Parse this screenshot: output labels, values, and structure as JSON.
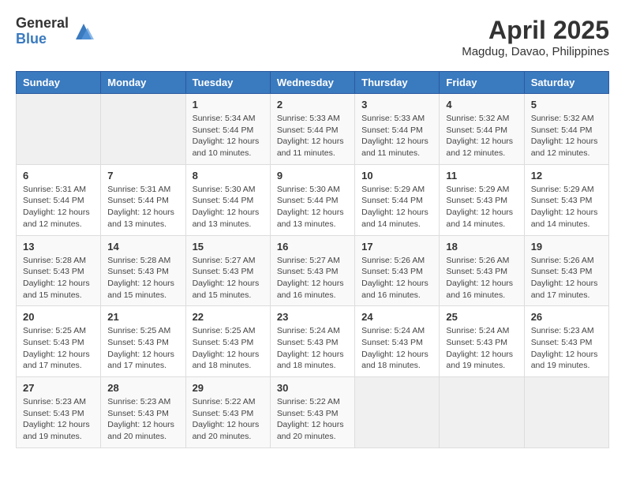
{
  "logo": {
    "general": "General",
    "blue": "Blue"
  },
  "title": {
    "month": "April 2025",
    "location": "Magdug, Davao, Philippines"
  },
  "weekdays": [
    "Sunday",
    "Monday",
    "Tuesday",
    "Wednesday",
    "Thursday",
    "Friday",
    "Saturday"
  ],
  "weeks": [
    [
      {
        "day": "",
        "info": ""
      },
      {
        "day": "",
        "info": ""
      },
      {
        "day": "1",
        "info": "Sunrise: 5:34 AM\nSunset: 5:44 PM\nDaylight: 12 hours\nand 10 minutes."
      },
      {
        "day": "2",
        "info": "Sunrise: 5:33 AM\nSunset: 5:44 PM\nDaylight: 12 hours\nand 11 minutes."
      },
      {
        "day": "3",
        "info": "Sunrise: 5:33 AM\nSunset: 5:44 PM\nDaylight: 12 hours\nand 11 minutes."
      },
      {
        "day": "4",
        "info": "Sunrise: 5:32 AM\nSunset: 5:44 PM\nDaylight: 12 hours\nand 12 minutes."
      },
      {
        "day": "5",
        "info": "Sunrise: 5:32 AM\nSunset: 5:44 PM\nDaylight: 12 hours\nand 12 minutes."
      }
    ],
    [
      {
        "day": "6",
        "info": "Sunrise: 5:31 AM\nSunset: 5:44 PM\nDaylight: 12 hours\nand 12 minutes."
      },
      {
        "day": "7",
        "info": "Sunrise: 5:31 AM\nSunset: 5:44 PM\nDaylight: 12 hours\nand 13 minutes."
      },
      {
        "day": "8",
        "info": "Sunrise: 5:30 AM\nSunset: 5:44 PM\nDaylight: 12 hours\nand 13 minutes."
      },
      {
        "day": "9",
        "info": "Sunrise: 5:30 AM\nSunset: 5:44 PM\nDaylight: 12 hours\nand 13 minutes."
      },
      {
        "day": "10",
        "info": "Sunrise: 5:29 AM\nSunset: 5:44 PM\nDaylight: 12 hours\nand 14 minutes."
      },
      {
        "day": "11",
        "info": "Sunrise: 5:29 AM\nSunset: 5:43 PM\nDaylight: 12 hours\nand 14 minutes."
      },
      {
        "day": "12",
        "info": "Sunrise: 5:29 AM\nSunset: 5:43 PM\nDaylight: 12 hours\nand 14 minutes."
      }
    ],
    [
      {
        "day": "13",
        "info": "Sunrise: 5:28 AM\nSunset: 5:43 PM\nDaylight: 12 hours\nand 15 minutes."
      },
      {
        "day": "14",
        "info": "Sunrise: 5:28 AM\nSunset: 5:43 PM\nDaylight: 12 hours\nand 15 minutes."
      },
      {
        "day": "15",
        "info": "Sunrise: 5:27 AM\nSunset: 5:43 PM\nDaylight: 12 hours\nand 15 minutes."
      },
      {
        "day": "16",
        "info": "Sunrise: 5:27 AM\nSunset: 5:43 PM\nDaylight: 12 hours\nand 16 minutes."
      },
      {
        "day": "17",
        "info": "Sunrise: 5:26 AM\nSunset: 5:43 PM\nDaylight: 12 hours\nand 16 minutes."
      },
      {
        "day": "18",
        "info": "Sunrise: 5:26 AM\nSunset: 5:43 PM\nDaylight: 12 hours\nand 16 minutes."
      },
      {
        "day": "19",
        "info": "Sunrise: 5:26 AM\nSunset: 5:43 PM\nDaylight: 12 hours\nand 17 minutes."
      }
    ],
    [
      {
        "day": "20",
        "info": "Sunrise: 5:25 AM\nSunset: 5:43 PM\nDaylight: 12 hours\nand 17 minutes."
      },
      {
        "day": "21",
        "info": "Sunrise: 5:25 AM\nSunset: 5:43 PM\nDaylight: 12 hours\nand 17 minutes."
      },
      {
        "day": "22",
        "info": "Sunrise: 5:25 AM\nSunset: 5:43 PM\nDaylight: 12 hours\nand 18 minutes."
      },
      {
        "day": "23",
        "info": "Sunrise: 5:24 AM\nSunset: 5:43 PM\nDaylight: 12 hours\nand 18 minutes."
      },
      {
        "day": "24",
        "info": "Sunrise: 5:24 AM\nSunset: 5:43 PM\nDaylight: 12 hours\nand 18 minutes."
      },
      {
        "day": "25",
        "info": "Sunrise: 5:24 AM\nSunset: 5:43 PM\nDaylight: 12 hours\nand 19 minutes."
      },
      {
        "day": "26",
        "info": "Sunrise: 5:23 AM\nSunset: 5:43 PM\nDaylight: 12 hours\nand 19 minutes."
      }
    ],
    [
      {
        "day": "27",
        "info": "Sunrise: 5:23 AM\nSunset: 5:43 PM\nDaylight: 12 hours\nand 19 minutes."
      },
      {
        "day": "28",
        "info": "Sunrise: 5:23 AM\nSunset: 5:43 PM\nDaylight: 12 hours\nand 20 minutes."
      },
      {
        "day": "29",
        "info": "Sunrise: 5:22 AM\nSunset: 5:43 PM\nDaylight: 12 hours\nand 20 minutes."
      },
      {
        "day": "30",
        "info": "Sunrise: 5:22 AM\nSunset: 5:43 PM\nDaylight: 12 hours\nand 20 minutes."
      },
      {
        "day": "",
        "info": ""
      },
      {
        "day": "",
        "info": ""
      },
      {
        "day": "",
        "info": ""
      }
    ]
  ]
}
